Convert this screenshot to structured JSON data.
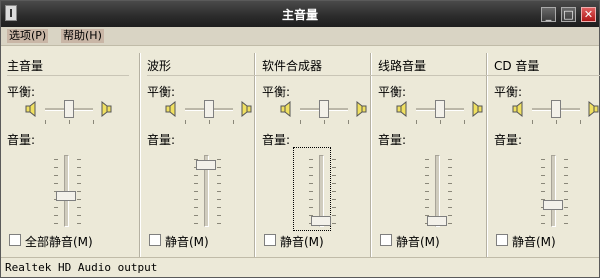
{
  "window": {
    "title": "主音量"
  },
  "titlebar": {
    "minimize": "_",
    "maximize": "□",
    "close": "✕"
  },
  "menu": [
    {
      "label": "选项(P)"
    },
    {
      "label": "帮助(H)"
    }
  ],
  "labels": {
    "balance": "平衡:",
    "volume": "音量:"
  },
  "channels": [
    {
      "name": "主音量",
      "mute_label": "全部静音(M)",
      "muted": false,
      "balance": 0.5,
      "volume": 0.45
    },
    {
      "name": "波形",
      "mute_label": "静音(M)",
      "muted": false,
      "balance": 0.5,
      "volume": 0.95
    },
    {
      "name": "软件合成器",
      "mute_label": "静音(M)",
      "muted": false,
      "balance": 0.5,
      "volume": 0.05
    },
    {
      "name": "线路音量",
      "mute_label": "静音(M)",
      "muted": false,
      "balance": 0.5,
      "volume": 0.05
    },
    {
      "name": "CD 音量",
      "mute_label": "静音(M)",
      "muted": false,
      "balance": 0.5,
      "volume": 0.3
    }
  ],
  "status": {
    "text": "Realtek HD Audio output"
  }
}
